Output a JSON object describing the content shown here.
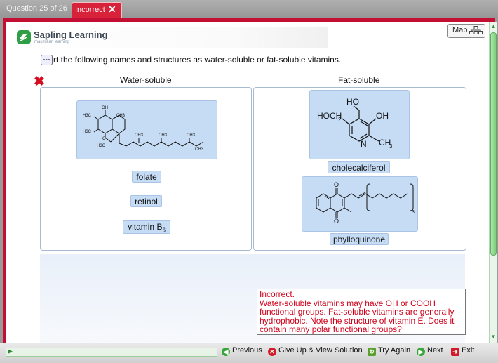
{
  "header": {
    "question_counter": "Question 25 of 26",
    "status_tab": "Incorrect"
  },
  "logo": {
    "brand": "Sapling Learning",
    "tagline": "macmillan learning"
  },
  "map_button": {
    "label": "Map"
  },
  "question": {
    "instruction": "Sort the following names and structures as water-soluble or fat-soluble vitamins.",
    "instruction_visible": "rt the following names and structures as water-soluble or fat-soluble vitamins."
  },
  "bins": {
    "water": {
      "title": "Water-soluble",
      "chips": [
        "folate",
        "retinol"
      ],
      "vitamin_b6_prefix": "vitamin B",
      "vitamin_b6_sub": "6"
    },
    "fat": {
      "title": "Fat-soluble",
      "chips": [
        "cholecalciferol",
        "phylloquinone"
      ]
    }
  },
  "structures": {
    "vitamin_e_labels": [
      "OH",
      "CH3",
      "H3C",
      "H3C",
      "H3C",
      "O",
      "CH3",
      "CH3",
      "CH3",
      "CH3"
    ],
    "pyridoxine_labels": {
      "ho": "HO",
      "hoch2": "HOCH",
      "hoch2_sub": "2",
      "oh": "OH",
      "n": "N",
      "ch3": "CH",
      "ch3_sub": "3"
    },
    "vitamin_k_labels": {
      "o1": "O",
      "o2": "O",
      "n3": "3"
    }
  },
  "feedback": {
    "heading": "Incorrect.",
    "text": "Water-soluble vitamins may have OH or COOH functional groups. Fat-soluble vitamins are generally hydrophobic. Note the structure of vitamin E. Does it contain many polar functional groups?"
  },
  "footer": {
    "previous": "Previous",
    "give_up": "Give Up & View Solution",
    "try_again": "Try Again",
    "next": "Next",
    "exit": "Exit"
  },
  "colors": {
    "accent_red": "#c40f35",
    "sapling_green": "#2f9e44",
    "chip_blue": "#c6dcf5",
    "feedback_red": "#d0021b"
  }
}
